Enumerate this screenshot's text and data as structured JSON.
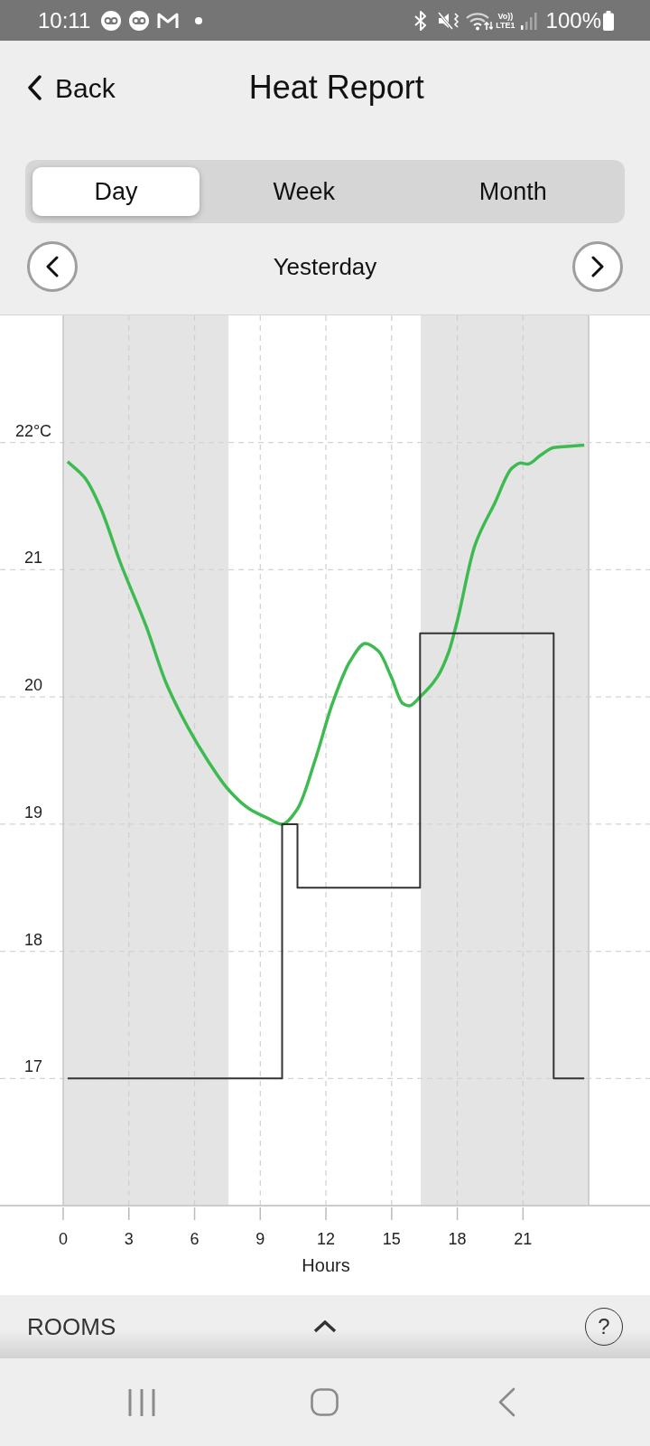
{
  "status_bar": {
    "time": "10:11",
    "network_label": [
      "Vo))",
      "LTE1"
    ],
    "battery": "100%"
  },
  "header": {
    "back_label": "Back",
    "title": "Heat Report"
  },
  "tabs": [
    {
      "label": "Day",
      "selected": true
    },
    {
      "label": "Week",
      "selected": false
    },
    {
      "label": "Month",
      "selected": false
    }
  ],
  "date_nav": {
    "label": "Yesterday"
  },
  "chart": {
    "chart_data": {
      "type": "line",
      "xlabel": "Hours",
      "x": [
        0.2,
        1,
        1.7,
        2.6,
        3.8,
        4.7,
        5.7,
        6.6,
        7.5,
        8.5,
        9.3,
        10,
        10,
        10.7,
        10.7,
        11.5,
        12.3,
        13.1,
        13.8,
        14.4,
        15,
        15.5,
        15.8,
        16.3,
        16.3,
        17.1,
        17.6,
        18,
        18.8,
        19.7,
        20.5,
        20.9,
        21.2,
        21.8,
        22.4,
        22.4,
        23,
        23.8
      ],
      "series": [
        {
          "color": "#3dbb50",
          "values": [
            21.85,
            21.72,
            21.49,
            21.06,
            20.55,
            20.11,
            19.76,
            19.5,
            19.28,
            19.12,
            19.05,
            19.0,
            19.0,
            19.12,
            19.12,
            19.5,
            19.95,
            20.28,
            20.42,
            20.36,
            20.15,
            19.95,
            19.93,
            20.0,
            20.0,
            20.16,
            20.35,
            20.6,
            21.19,
            21.52,
            21.8,
            21.84,
            21.83,
            21.9,
            21.96,
            21.96,
            21.97,
            21.98
          ]
        },
        {
          "color": "#333333",
          "values": [
            17,
            17,
            17,
            17,
            17,
            17,
            17,
            17,
            17,
            17,
            17,
            17,
            19,
            19,
            18.5,
            18.5,
            18.5,
            18.5,
            18.5,
            18.5,
            18.5,
            18.5,
            18.5,
            18.5,
            20.5,
            20.5,
            20.5,
            20.5,
            20.5,
            20.5,
            20.5,
            20.5,
            20.5,
            20.5,
            20.5,
            17,
            17,
            17
          ]
        }
      ],
      "xlim": [
        0,
        26.8
      ],
      "ylim": [
        16,
        23
      ],
      "xticks": [
        0,
        3,
        6,
        9,
        12,
        15,
        18,
        21
      ],
      "yticks": [
        17,
        18,
        19,
        20,
        21,
        {
          "value": 22,
          "label": "22°C"
        }
      ],
      "grid": true,
      "bands": [
        {
          "axis": "x",
          "from": 0,
          "to": 7.55
        },
        {
          "axis": "x",
          "from": 16.33,
          "to": 24
        }
      ],
      "ref_lines": [
        {
          "axis": "x",
          "value": 24
        }
      ]
    }
  },
  "rooms_bar": {
    "label": "ROOMS",
    "expanded": false,
    "help_label": "?"
  }
}
